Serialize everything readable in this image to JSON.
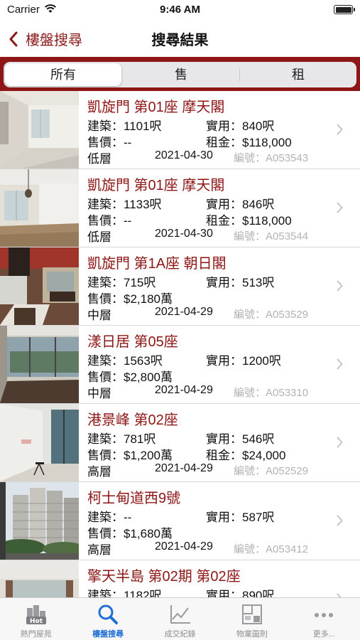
{
  "status_bar": {
    "carrier": "Carrier",
    "time": "9:46 AM"
  },
  "nav": {
    "back_label": "樓盤搜尋",
    "title": "搜尋結果"
  },
  "filter": {
    "tabs": [
      "所有",
      "售",
      "租"
    ],
    "selected": "所有"
  },
  "listings": [
    {
      "title": "凱旋門 第01座 摩天閣",
      "gross": "建築：1101呎",
      "saleable": "實用：840呎",
      "price": "售價：--",
      "rent": "租金：$118,000",
      "floor": "低層",
      "date": "2021-04-30",
      "code": "編號：A053543"
    },
    {
      "title": "凱旋門 第01座 摩天閣",
      "gross": "建築：1133呎",
      "saleable": "實用：846呎",
      "price": "售價：--",
      "rent": "租金：$118,000",
      "floor": "低層",
      "date": "2021-04-30",
      "code": "編號：A053544"
    },
    {
      "title": "凱旋門 第1A座 朝日閣",
      "gross": "建築：715呎",
      "saleable": "實用：513呎",
      "price": "售價：$2,180萬",
      "rent": "",
      "floor": "中層",
      "date": "2021-04-29",
      "code": "編號：A053529"
    },
    {
      "title": "漾日居 第05座",
      "gross": "建築：1563呎",
      "saleable": "實用：1200呎",
      "price": "售價：$2,800萬",
      "rent": "",
      "floor": "中層",
      "date": "2021-04-29",
      "code": "編號：A053310"
    },
    {
      "title": "港景峰 第02座",
      "gross": "建築：781呎",
      "saleable": "實用：546呎",
      "price": "售價：$1,200萬",
      "rent": "租金：$24,000",
      "floor": "高層",
      "date": "2021-04-29",
      "code": "編號：A052529"
    },
    {
      "title": "柯士甸道西9號",
      "gross": "建築：--",
      "saleable": "實用：587呎",
      "price": "售價：$1,680萬",
      "rent": "",
      "floor": "高層",
      "date": "2021-04-29",
      "code": "編號：A053412"
    },
    {
      "title": "擎天半島 第02期 第02座",
      "gross": "建築：1182呎",
      "saleable": "實用：890呎",
      "price": "",
      "rent": "",
      "floor": "",
      "date": "",
      "code": ""
    }
  ],
  "tab_bar": {
    "items": [
      {
        "label": "熱門屋苑",
        "icon": "hot-buildings-icon"
      },
      {
        "label": "樓盤搜尋",
        "icon": "search-icon"
      },
      {
        "label": "成交紀錄",
        "icon": "line-chart-icon"
      },
      {
        "label": "物業圖則",
        "icon": "floor-plan-icon"
      },
      {
        "label": "更多...",
        "icon": "more-icon"
      }
    ],
    "selected": "樓盤搜尋"
  },
  "colors": {
    "brand": "#8e1616",
    "active_tab": "#1f6fd6",
    "code_text": "#b3b3b3"
  }
}
